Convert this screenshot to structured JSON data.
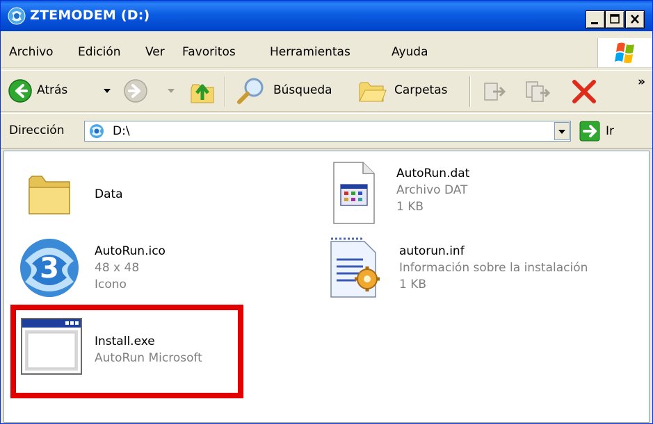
{
  "window": {
    "title": "ZTEMODEM (D:)",
    "title_color": "#0a5be0",
    "highlight_color": "#e00000"
  },
  "menu": {
    "items": [
      "Archivo",
      "Edición",
      "Ver",
      "Favoritos",
      "Herramientas",
      "Ayuda"
    ]
  },
  "toolbar": {
    "back_label": "Atrás",
    "search_label": "Búsqueda",
    "folders_label": "Carpetas",
    "overflow": "»"
  },
  "address": {
    "label": "Dirección",
    "value": "D:\\",
    "go_label": "Ir"
  },
  "files": [
    {
      "name": "Data",
      "icon": "folder-icon"
    },
    {
      "name": "AutoRun.dat",
      "type": "Archivo DAT",
      "size": "1 KB",
      "icon": "dat-file-icon"
    },
    {
      "name": "AutoRun.ico",
      "dims": "48 x 48",
      "type": "Icono",
      "icon": "autorun-ico-icon"
    },
    {
      "name": "autorun.inf",
      "type": "Información sobre la instalación",
      "size": "1 KB",
      "icon": "inf-file-icon"
    },
    {
      "name": "Install.exe",
      "type": "AutoRun Microsoft",
      "icon": "exe-window-icon"
    }
  ]
}
